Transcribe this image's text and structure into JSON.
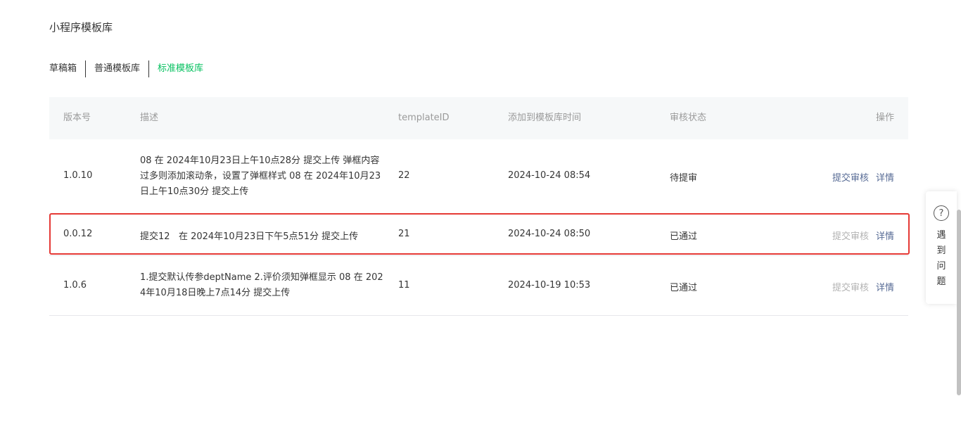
{
  "page": {
    "title": "小程序模板库"
  },
  "tabs": [
    {
      "label": "草稿箱"
    },
    {
      "label": "普通模板库"
    },
    {
      "label": "标准模板库"
    }
  ],
  "table": {
    "columns": {
      "version": "版本号",
      "description": "描述",
      "template_id": "templateID",
      "added_time": "添加到模板库时间",
      "review_status": "审核状态",
      "actions": "操作"
    },
    "rows": [
      {
        "version": "1.0.10",
        "description": "08 在 2024年10月23日上午10点28分 提交上传 弹框内容过多则添加滚动条，设置了弹框样式 08 在 2024年10月23日上午10点30分 提交上传",
        "template_id": "22",
        "added_time": "2024-10-24 08:54",
        "review_status": "待提审",
        "submit_label": "提交审核",
        "detail_label": "详情"
      },
      {
        "version": "0.0.12",
        "description": "提交12   在 2024年10月23日下午5点51分 提交上传",
        "template_id": "21",
        "added_time": "2024-10-24 08:50",
        "review_status": "已通过",
        "submit_label": "提交审核",
        "detail_label": "详情"
      },
      {
        "version": "1.0.6",
        "description": "1.提交默认传参deptName 2.评价须知弹框显示 08 在 2024年10月18日晚上7点14分 提交上传",
        "template_id": "11",
        "added_time": "2024-10-19 10:53",
        "review_status": "已通过",
        "submit_label": "提交审核",
        "detail_label": "详情"
      }
    ]
  },
  "help": {
    "icon": "question-circle-icon",
    "label": "遇到问题"
  },
  "colors": {
    "accent": "#07c160",
    "link": "#576b95",
    "disabled": "#b2b2b2",
    "highlight": "#e53935"
  }
}
